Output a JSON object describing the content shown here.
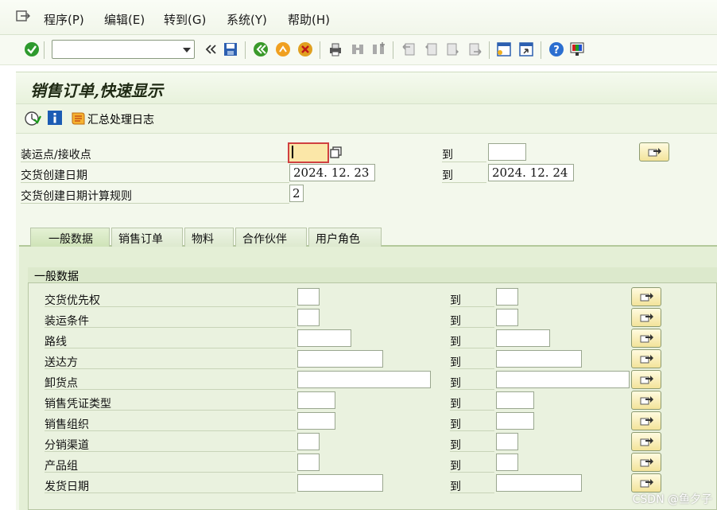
{
  "menu": {
    "items": [
      "程序(P)",
      "编辑(E)",
      "转到(G)",
      "系统(Y)",
      "帮助(H)"
    ]
  },
  "toolbar": {
    "command_value": ""
  },
  "title": "销售订单,快速显示",
  "app_toolbar": {
    "log_label": "汇总处理日志"
  },
  "header_fields": [
    {
      "label": "装运点/接收点",
      "from": "",
      "to_label": "到",
      "to": ""
    },
    {
      "label": "交货创建日期",
      "from": "2024. 12. 23",
      "to_label": "到",
      "to": "2024. 12. 24"
    },
    {
      "label": "交货创建日期计算规则",
      "value": "2"
    }
  ],
  "tabs": [
    "一般数据",
    "销售订单",
    "物料",
    "合作伙伴",
    "用户角色"
  ],
  "group": {
    "title": "一般数据",
    "to_label": "到",
    "fields": [
      "交货优先权",
      "装运条件",
      "路线",
      "送达方",
      "卸货点",
      "销售凭证类型",
      "销售组织",
      "分销渠道",
      "产品组",
      "发货日期"
    ]
  },
  "watermark": "CSDN @鱼夕子",
  "colors": {
    "accent": "#1b8a1b",
    "button_yellow": "#f3e39a",
    "panel_green": "#e4efd6"
  }
}
